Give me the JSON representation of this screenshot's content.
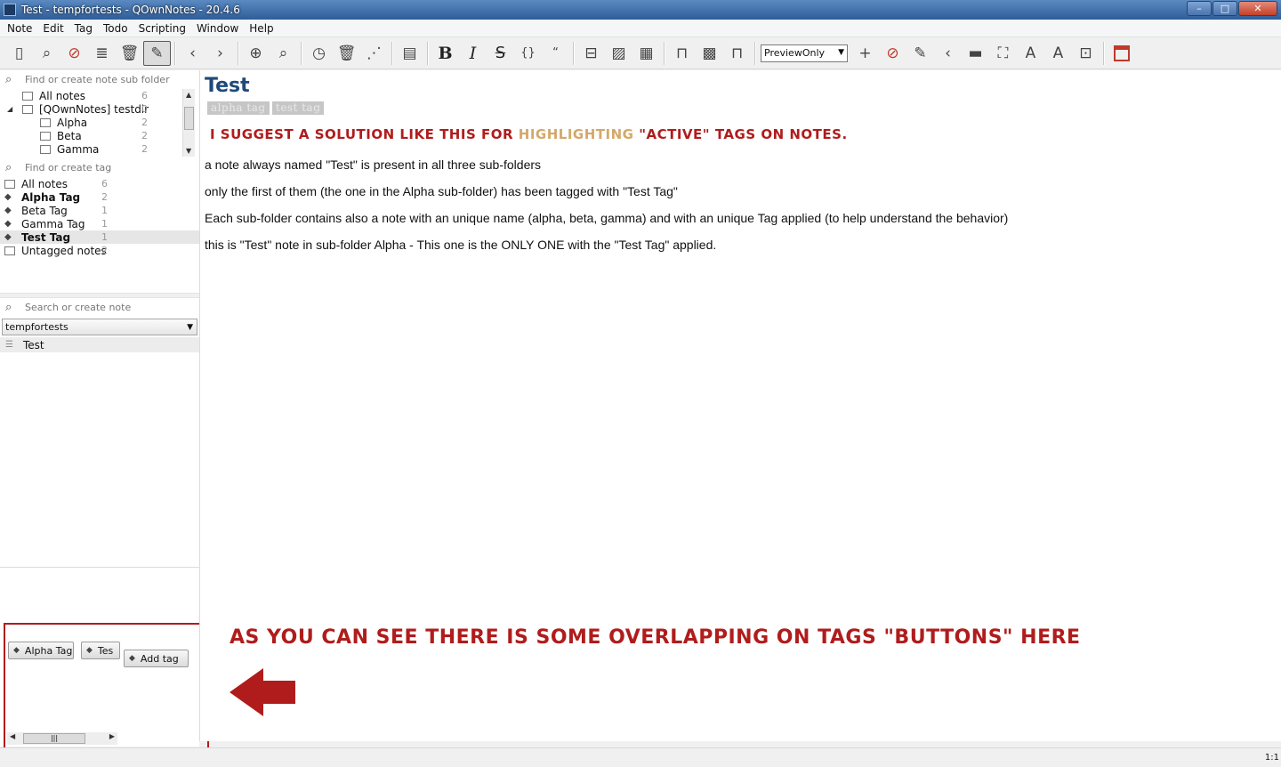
{
  "window": {
    "title": "Test - tempfortests - QOwnNotes - 20.4.6"
  },
  "menu": [
    "Note",
    "Edit",
    "Tag",
    "Todo",
    "Scripting",
    "Window",
    "Help"
  ],
  "toolbar": {
    "preview_mode": "PreviewOnly"
  },
  "folders": {
    "search_placeholder": "Find or create note sub folder",
    "items": [
      {
        "label": "All notes",
        "count": "6"
      },
      {
        "label": "[QOwnNotes] testdir",
        "count": "0"
      },
      {
        "label": "Alpha",
        "count": "2"
      },
      {
        "label": "Beta",
        "count": "2"
      },
      {
        "label": "Gamma",
        "count": "2"
      }
    ]
  },
  "tags": {
    "search_placeholder": "Find or create tag",
    "items": [
      {
        "label": "All notes",
        "count": "6"
      },
      {
        "label": "Alpha Tag",
        "count": "2"
      },
      {
        "label": "Beta Tag",
        "count": "1"
      },
      {
        "label": "Gamma Tag",
        "count": "1"
      },
      {
        "label": "Test Tag",
        "count": "1"
      },
      {
        "label": "Untagged notes",
        "count": "2"
      }
    ]
  },
  "notes": {
    "search_placeholder": "Search or create note",
    "folder": "tempfortests",
    "items": [
      "Test"
    ]
  },
  "tag_buttons": {
    "alpha": "Alpha Tag",
    "test": "Tes",
    "add": "Add tag"
  },
  "editor": {
    "title": "Test",
    "header_tags": [
      "alpha tag",
      "test tag"
    ],
    "suggest_pre": "I suggest a solution like this for",
    "suggest_hl": "highlighting",
    "suggest_post": "\"active\" tags on notes.",
    "lines": [
      "a note always named \"Test\" is present in all three sub-folders",
      "only the first of them (the one in the Alpha sub-folder) has been tagged with \"Test Tag\"",
      "Each sub-folder contains also a note with an unique name (alpha, beta, gamma) and with an unique Tag applied (to help understand the behavior)",
      "this is \"Test\" note in sub-folder Alpha - This one is the ONLY ONE with the \"Test Tag\" applied."
    ]
  },
  "annotation": {
    "callout": "AS YOU CAN SEE THERE IS SOME OVERLAPPING ON TAGS \"BUTTONS\" HERE"
  },
  "statusbar": {
    "position": "1:1"
  },
  "colors": {
    "accent_red": "#b01c1c",
    "title_blue": "#1e4a7a",
    "highlight": "#d4a86b"
  }
}
